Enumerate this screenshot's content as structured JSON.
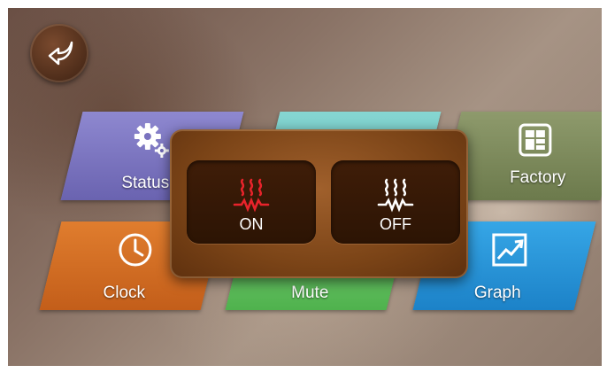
{
  "menu": {
    "status": "Status",
    "factory": "Factory",
    "clock": "Clock",
    "mute": "Mute",
    "graph": "Graph"
  },
  "heater_dialog": {
    "on_label": "ON",
    "off_label": "OFF",
    "on_color": "#e8232b",
    "off_color": "#ffffff"
  },
  "icons": {
    "back": "back-arrow-icon",
    "status": "gears-icon",
    "factory": "grid-panel-icon",
    "clock": "clock-icon",
    "graph": "chart-trend-icon",
    "heat_on": "heater-icon",
    "heat_off": "heater-icon"
  },
  "colors": {
    "status_tile": "#7c76c2",
    "mute_top_tile": "#72c8c4",
    "factory_tile": "#7d8a5c",
    "clock_tile": "#d26e24",
    "mute_tile": "#67c164",
    "graph_tile": "#2994d7",
    "dialog": "#7b4417"
  }
}
